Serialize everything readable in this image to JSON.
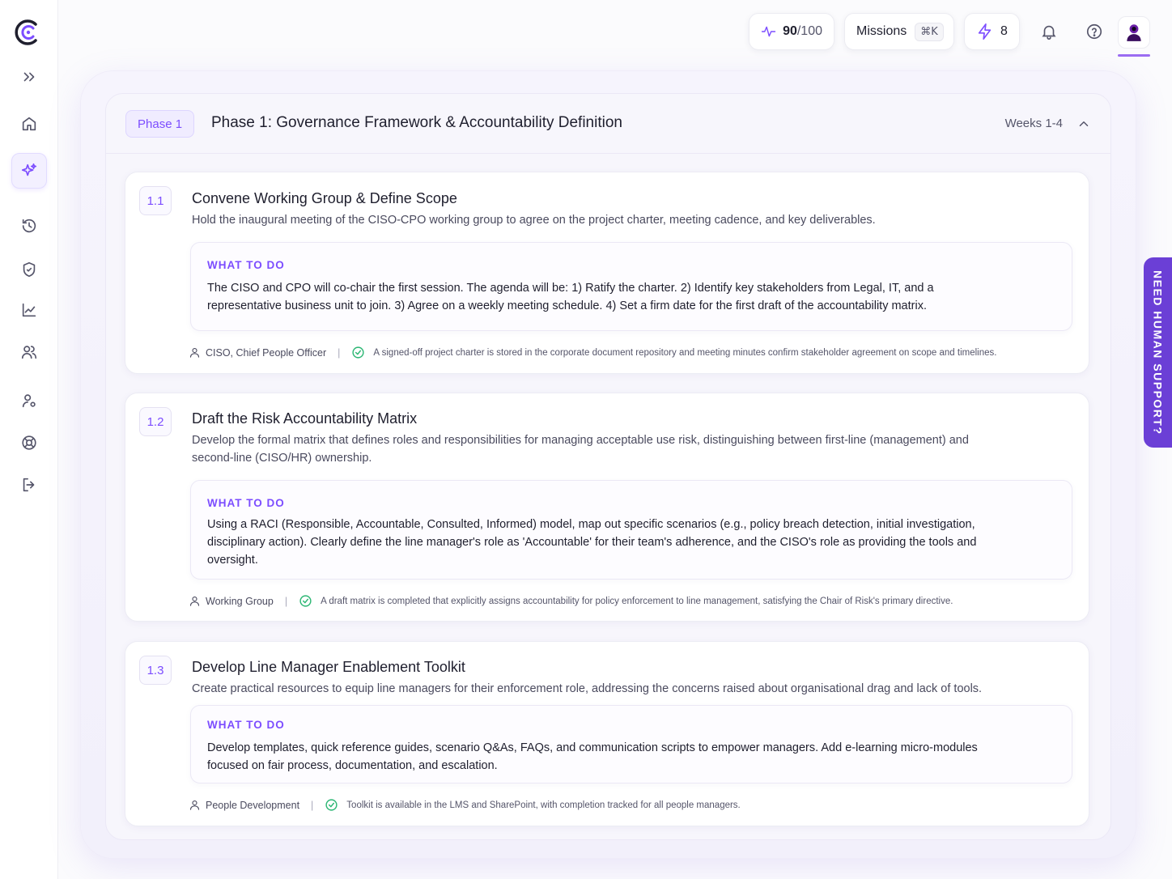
{
  "topbar": {
    "score_value": "90",
    "score_total": "/100",
    "missions_label": "Missions",
    "missions_shortcut": "⌘K",
    "energy_count": "8"
  },
  "phase": {
    "badge": "Phase 1",
    "title": "Phase 1: Governance Framework & Accountability Definition",
    "weeks": "Weeks 1-4"
  },
  "tasks": [
    {
      "number": "1.1",
      "title": "Convene Working Group & Define Scope",
      "description": "Hold the inaugural meeting of the CISO-CPO working group to agree on the project charter, meeting cadence, and key deliverables.",
      "todo_label": "WHAT TO DO",
      "todo_text": "The CISO and CPO will co-chair the first session. The agenda will be: 1) Ratify the charter. 2) Identify key stakeholders from Legal, IT, and a representative business unit to join. 3) Agree on a weekly meeting schedule. 4) Set a firm date for the first draft of the accountability matrix.",
      "owner": "CISO, Chief People Officer",
      "separator": "|",
      "criteria": "A signed-off project charter is stored in the corporate document repository and meeting minutes confirm stakeholder agreement on scope and timelines."
    },
    {
      "number": "1.2",
      "title": "Draft the Risk Accountability Matrix",
      "description": "Develop the formal matrix that defines roles and responsibilities for managing acceptable use risk, distinguishing between first-line (management) and second-line (CISO/HR) ownership.",
      "todo_label": "WHAT TO DO",
      "todo_text": "Using a RACI (Responsible, Accountable, Consulted, Informed) model, map out specific scenarios (e.g., policy breach detection, initial investigation, disciplinary action). Clearly define the line manager's role as 'Accountable' for their team's adherence, and the CISO's role as providing the tools and oversight.",
      "owner": "Working Group",
      "separator": "|",
      "criteria": "A draft matrix is completed that explicitly assigns accountability for policy enforcement to line management, satisfying the Chair of Risk's primary directive."
    },
    {
      "number": "1.3",
      "title": "Develop Line Manager Enablement Toolkit",
      "description": "Create practical resources to equip line managers for their enforcement role, addressing the concerns raised about organisational drag and lack of tools.",
      "todo_label": "WHAT TO DO",
      "todo_text": "Develop templates, quick reference guides, scenario Q&As, FAQs, and communication scripts to empower managers. Add e-learning micro-modules focused on fair process, documentation, and escalation.",
      "owner": "People Development",
      "separator": "|",
      "criteria": "Toolkit is available in the LMS and SharePoint, with completion tracked for all people managers."
    }
  ],
  "support_tab": "NEED HUMAN SUPPORT?",
  "icons": {
    "sidebar": [
      "expand-icon",
      "home-icon",
      "sparkle-icon",
      "history-icon",
      "shield-icon",
      "chart-icon",
      "users-icon",
      "user-settings-icon",
      "lifebuoy-icon",
      "logout-icon"
    ],
    "topbar": [
      "pulse-icon",
      "bolt-icon",
      "bell-icon",
      "help-icon",
      "avatar"
    ]
  },
  "colors": {
    "accent": "#7c4dff",
    "support": "#6b3fd6",
    "check": "#2bb673"
  }
}
